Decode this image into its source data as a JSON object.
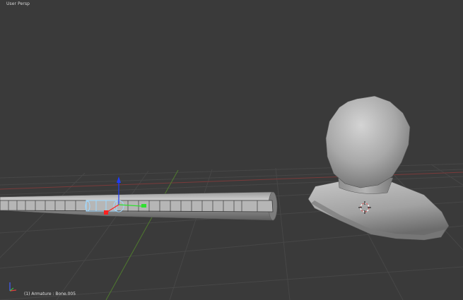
{
  "viewport": {
    "view_label": "User Persp",
    "status_text": "(1) Armature : Bone.005"
  },
  "colors": {
    "background": "#3a3a3a",
    "grid": "#474747",
    "grid_x_axis": "#7a3a3a",
    "grid_y_axis": "#4f7a2e",
    "mesh_light": "#b8b8b8",
    "mesh_dark": "#6a6a6a",
    "selection_outline": "#9fd8ff",
    "gizmo_z": "#1e3cff",
    "gizmo_x": "#ff2020",
    "gizmo_y": "#30e030"
  },
  "icons": {
    "axis_widget": "axis-orientation-icon",
    "cursor_3d": "3d-cursor-icon"
  }
}
